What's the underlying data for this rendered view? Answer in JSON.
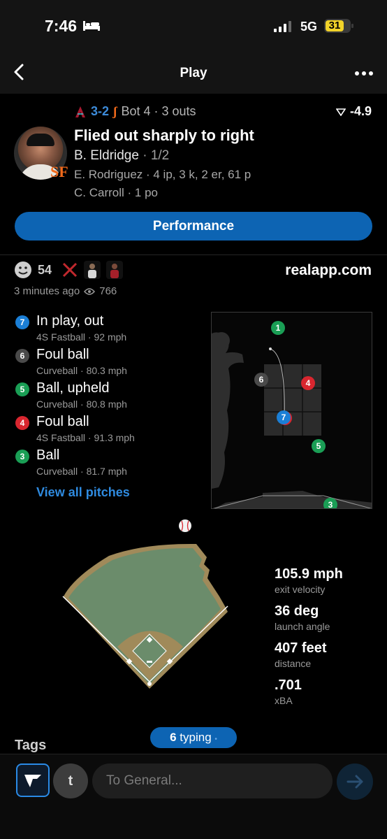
{
  "status": {
    "time": "7:46",
    "network": "5G",
    "battery": "31"
  },
  "nav": {
    "title": "Play"
  },
  "play": {
    "score": "3-2",
    "inning": "Bot 4 · 3 outs",
    "wpa": "-4.9",
    "headline": "Flied out sharply to right",
    "batter": "B. Eldridge",
    "batter_line": "· 1/2",
    "pitcher_line": "E. Rodriguez · 4 ip, 3 k, 2 er, 61 p",
    "fielder_line": "C. Carroll · 1 po",
    "team_badge": "SF",
    "button": "Performance"
  },
  "social": {
    "reactions": "54",
    "site": "realapp.com",
    "time_ago": "3 minutes ago",
    "views": "766"
  },
  "pitches": [
    {
      "num": "7",
      "color": "#1b7fd6",
      "result": "In play, out",
      "detail": "4S Fastball · 92 mph"
    },
    {
      "num": "6",
      "color": "#4a4a4a",
      "result": "Foul ball",
      "detail": "Curveball · 80.3 mph"
    },
    {
      "num": "5",
      "color": "#1a9e55",
      "result": "Ball, upheld",
      "detail": "Curveball · 80.8 mph"
    },
    {
      "num": "4",
      "color": "#d9262f",
      "result": "Foul ball",
      "detail": "4S Fastball · 91.3 mph"
    },
    {
      "num": "3",
      "color": "#1a9e55",
      "result": "Ball",
      "detail": "Curveball · 81.7 mph"
    }
  ],
  "zone_marks": [
    "1",
    "6",
    "4",
    "7",
    "5",
    "3"
  ],
  "view_all": "View all pitches",
  "stats": [
    {
      "value": "105.9 mph",
      "label": "exit velocity"
    },
    {
      "value": "36 deg",
      "label": "launch angle"
    },
    {
      "value": "407 feet",
      "label": "distance"
    },
    {
      "value": ".701",
      "label": "xBA"
    }
  ],
  "typing": {
    "count": "6",
    "text": "typing"
  },
  "tags": "Tags",
  "composer": {
    "avatar_letter": "t",
    "placeholder": "To General..."
  },
  "colors": {
    "accent": "#0d64b3",
    "link": "#2f8be0",
    "giants_orange": "#f26a1b",
    "field_green": "#6b8c6b",
    "field_tan": "#a08a5a"
  }
}
